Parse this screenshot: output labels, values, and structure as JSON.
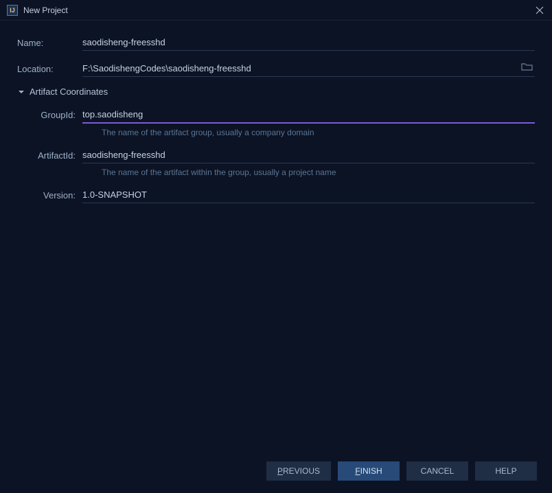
{
  "window": {
    "title": "New Project",
    "icon_text": "IJ"
  },
  "form": {
    "name_label": "Name:",
    "name_value": "saodisheng-freesshd",
    "location_label": "Location:",
    "location_value": "F:\\SaodishengCodes\\saodisheng-freesshd"
  },
  "artifact": {
    "section_title": "Artifact Coordinates",
    "groupid_label": "GroupId:",
    "groupid_value": "top.saodisheng",
    "groupid_hint": "The name of the artifact group, usually a company domain",
    "artifactid_label": "ArtifactId:",
    "artifactid_value": "saodisheng-freesshd",
    "artifactid_hint": "The name of the artifact within the group, usually a project name",
    "version_label": "Version:",
    "version_value": "1.0-SNAPSHOT"
  },
  "buttons": {
    "previous": "REVIOUS",
    "previous_u": "P",
    "finish": "INISH",
    "finish_u": "F",
    "cancel": "CANCEL",
    "help": "HELP"
  }
}
